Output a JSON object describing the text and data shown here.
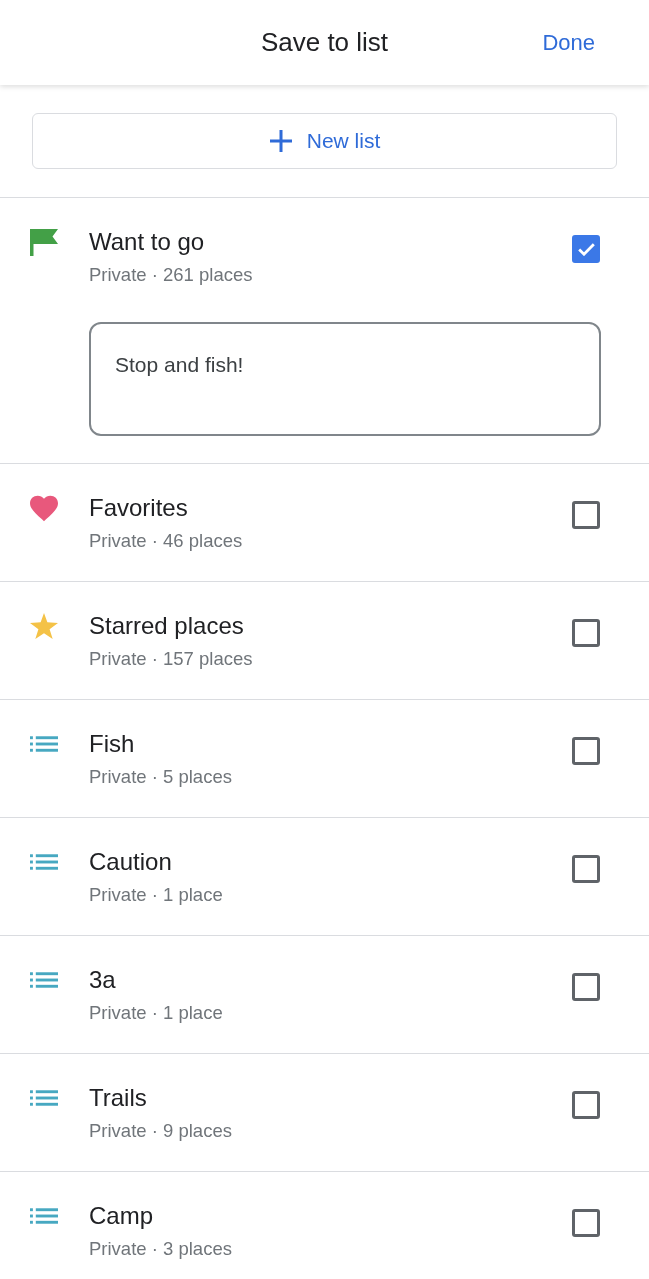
{
  "header": {
    "title": "Save to list",
    "done_button": "Done"
  },
  "new_list_button": {
    "label": "New list"
  },
  "lists": [
    {
      "kind": "flag",
      "name": "Want to go",
      "details": "Private · 261 places",
      "checked": true,
      "note": {
        "value": "Stop and fish!"
      }
    },
    {
      "kind": "heart",
      "name": "Favorites",
      "details": "Private · 46 places",
      "checked": false
    },
    {
      "kind": "star",
      "name": "Starred places",
      "details": "Private · 157 places",
      "checked": false
    },
    {
      "kind": "list",
      "name": "Fish",
      "details": "Private · 5 places",
      "checked": false
    },
    {
      "kind": "list",
      "name": "Caution",
      "details": "Private · 1 place",
      "checked": false
    },
    {
      "kind": "list",
      "name": "3a",
      "details": "Private · 1 place",
      "checked": false
    },
    {
      "kind": "list",
      "name": "Trails",
      "details": "Private · 9 places",
      "checked": false
    },
    {
      "kind": "list",
      "name": "Camp",
      "details": "Private · 3 places",
      "checked": false
    }
  ]
}
